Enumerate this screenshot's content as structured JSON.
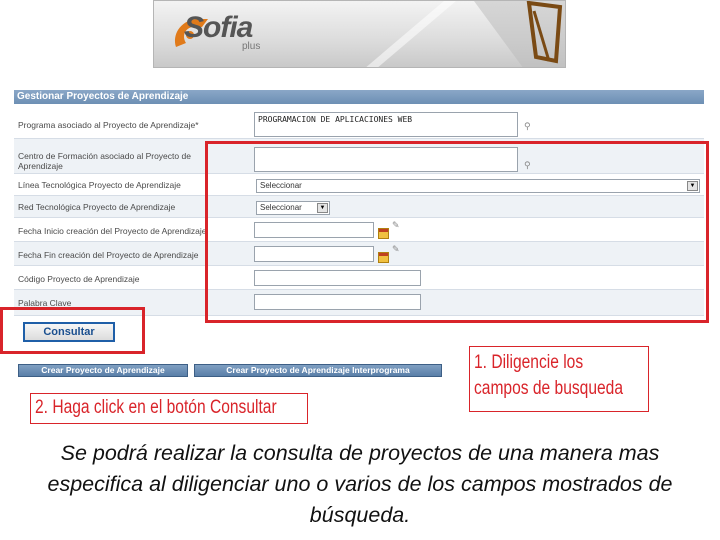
{
  "banner": {
    "logo_text": "Sofia",
    "logo_subtext": "plus"
  },
  "panel": {
    "title": "Gestionar Proyectos de Aprendizaje",
    "fields": [
      {
        "label": "Programa asociado al Proyecto de Aprendizaje*",
        "value": "PROGRAMACION DE APLICACIONES WEB"
      },
      {
        "label_line1": "Centro de Formación asociado al Proyecto de",
        "label_line2": "Aprendizaje",
        "value": ""
      },
      {
        "label": "Línea Tecnológica Proyecto de Aprendizaje",
        "value": "Seleccionar"
      },
      {
        "label": "Red Tecnológica Proyecto de Aprendizaje",
        "value": "Seleccionar"
      },
      {
        "label": "Fecha Inicio creación del Proyecto de Aprendizaje",
        "value": ""
      },
      {
        "label": "Fecha Fin creación del Proyecto de Aprendizaje",
        "value": ""
      },
      {
        "label": "Código Proyecto de Aprendizaje",
        "value": ""
      },
      {
        "label": "Palabra Clave",
        "value": ""
      }
    ],
    "buttons": {
      "consultar": "Consultar",
      "crear": "Crear Proyecto de Aprendizaje",
      "crear_inter": "Crear Proyecto de Aprendizaje Interprograma"
    }
  },
  "annotations": {
    "step1_line1": "1. Diligencie los",
    "step1_line2": "campos de busqueda",
    "step2": "2. Haga click en el botón Consultar",
    "color": "#d9242a"
  },
  "caption": "Se podrá realizar la consulta de proyectos de una manera mas especifica al diligenciar uno o varios de los campos mostrados de búsqueda."
}
